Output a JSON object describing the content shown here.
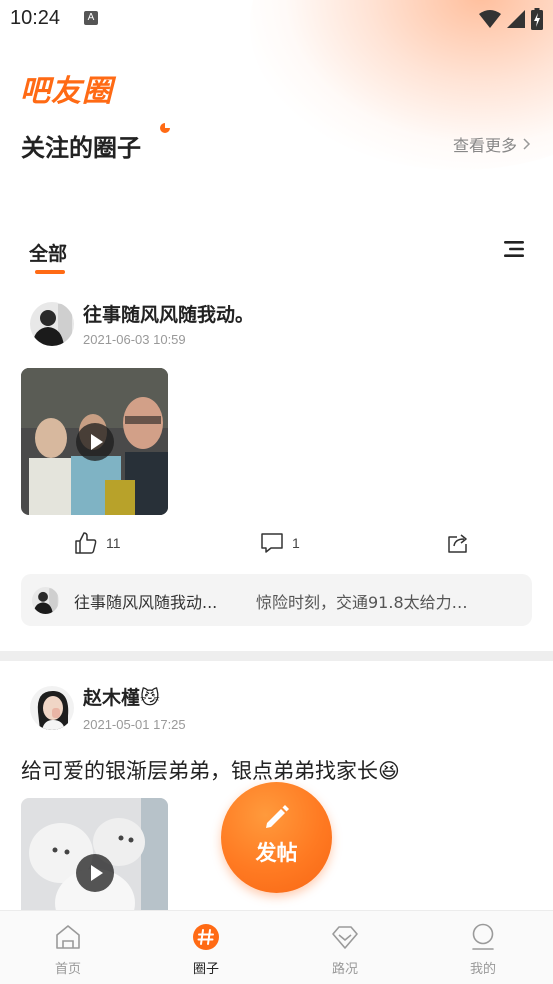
{
  "status_bar": {
    "time": "10:24",
    "notification_glyph": "A"
  },
  "header": {
    "brand": "吧友圈",
    "followed_title": "关注的圈子",
    "see_more": "查看更多"
  },
  "tabs": {
    "active": "全部"
  },
  "posts": [
    {
      "author": "往事随风风随我动。",
      "time": "2021-06-03 10:59",
      "text": "",
      "likes": "11",
      "comments": "1",
      "top_comment": {
        "author": "往事随风风随我动...",
        "text": "惊险时刻，交通91.8太给力…"
      }
    },
    {
      "author": "赵木槿😼",
      "time": "2021-05-01 17:25",
      "text": "给可爱的银渐层弟弟，银点弟弟找家长😆"
    }
  ],
  "fab": {
    "label": "发帖"
  },
  "bottom_nav": [
    {
      "label": "首页",
      "icon": "home-icon"
    },
    {
      "label": "圈子",
      "icon": "circle-hash-icon",
      "active": true
    },
    {
      "label": "路况",
      "icon": "road-diamond-icon"
    },
    {
      "label": "我的",
      "icon": "profile-icon"
    }
  ],
  "colors": {
    "accent": "#ff6a14",
    "separator": "#eeeeee",
    "muted": "#999999"
  }
}
